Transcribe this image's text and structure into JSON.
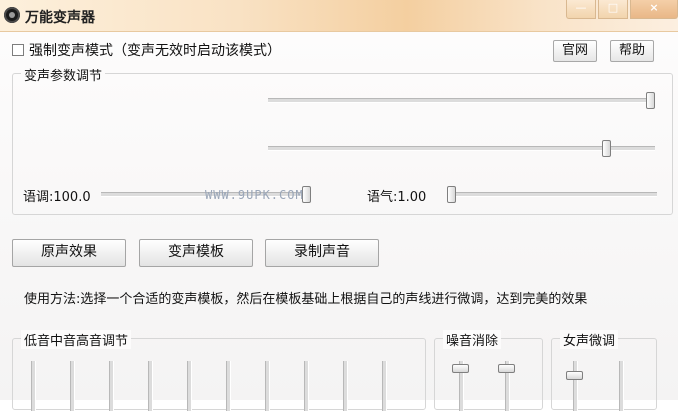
{
  "window": {
    "title": "万能变声器",
    "controls": {
      "minimize": "—",
      "maximize": "□",
      "close": "×"
    }
  },
  "options": {
    "force_mode_label": "强制变声模式（变声无效时启动该模式）",
    "force_mode_checked": false
  },
  "header_buttons": {
    "website": "官网",
    "help": "帮助"
  },
  "params_group": {
    "title": "变声参数调节",
    "sliders": [
      {
        "label": "",
        "value_fraction": 1.0
      },
      {
        "label": "",
        "value_fraction": 0.87
      },
      {
        "label": "语调:100.0",
        "value_fraction": 1.0
      },
      {
        "label": "语气:1.00",
        "value_fraction": 0.0
      }
    ],
    "watermark": "WWW.9UPK.COM"
  },
  "action_buttons": {
    "original": "原声效果",
    "template": "变声模板",
    "record": "录制声音"
  },
  "usage_text": "使用方法:选择一个合适的变声模板，然后在模板基础上根据自己的声线进行微调，达到完美的效果",
  "eq_group": {
    "title": "低音中音高音调节",
    "bands": 10
  },
  "noise_group": {
    "title": "噪音消除",
    "sliders": 2
  },
  "female_group": {
    "title": "女声微调",
    "sliders": 2
  }
}
